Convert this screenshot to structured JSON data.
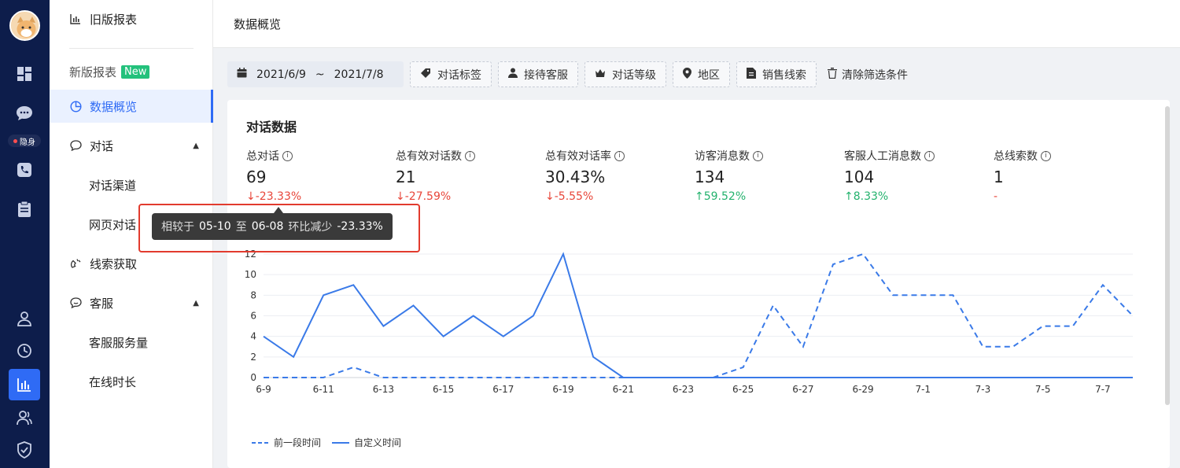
{
  "rail": {
    "status": "隐身",
    "icons": [
      "dashboard-icon",
      "chat-icon",
      "phone-icon",
      "clipboard-icon",
      "user-icon",
      "clock-icon",
      "chart-icon",
      "team-icon",
      "shield-icon"
    ]
  },
  "sidebar": {
    "old_report": "旧版报表",
    "new_report": "新版报表",
    "new_badge": "New",
    "items": [
      {
        "label": "数据概览"
      },
      {
        "label": "对话"
      },
      {
        "label": "对话渠道"
      },
      {
        "label": "网页对话"
      },
      {
        "label": "线索获取"
      },
      {
        "label": "客服"
      },
      {
        "label": "客服服务量"
      },
      {
        "label": "在线时长"
      }
    ]
  },
  "header": {
    "title": "数据概览"
  },
  "filters": {
    "date_start": "2021/6/9",
    "date_sep": "~",
    "date_end": "2021/7/8",
    "chips": [
      "对话标签",
      "接待客服",
      "对话等级",
      "地区",
      "销售线索"
    ],
    "clear": "清除筛选条件"
  },
  "card": {
    "title": "对话数据",
    "metrics": [
      {
        "label": "总对话",
        "value": "69",
        "change": "-23.33%",
        "dir": "down"
      },
      {
        "label": "总有效对话数",
        "value": "21",
        "change": "-27.59%",
        "dir": "down"
      },
      {
        "label": "总有效对话率",
        "value": "30.43%",
        "change": "-5.55%",
        "dir": "down"
      },
      {
        "label": "访客消息数",
        "value": "134",
        "change": "59.52%",
        "dir": "up"
      },
      {
        "label": "客服人工消息数",
        "value": "104",
        "change": "8.33%",
        "dir": "up"
      },
      {
        "label": "总线索数",
        "value": "1",
        "change": "-",
        "dir": "none"
      }
    ]
  },
  "tooltip": {
    "prefix": "相较于",
    "from": "05-10",
    "to_word": "至",
    "to": "06-08",
    "desc": "环比减少",
    "value": "-23.33%"
  },
  "chart_data": {
    "type": "line",
    "x": [
      "6-9",
      "6-10",
      "6-11",
      "6-12",
      "6-13",
      "6-14",
      "6-15",
      "6-16",
      "6-17",
      "6-18",
      "6-19",
      "6-20",
      "6-21",
      "6-22",
      "6-23",
      "6-24",
      "6-25",
      "6-26",
      "6-27",
      "6-28",
      "6-29",
      "6-30",
      "7-1",
      "7-2",
      "7-3",
      "7-4",
      "7-5",
      "7-6",
      "7-7",
      "7-8"
    ],
    "x_tick_labels": [
      "6-9",
      "6-11",
      "6-13",
      "6-15",
      "6-17",
      "6-19",
      "6-21",
      "6-23",
      "6-25",
      "6-27",
      "6-29",
      "7-1",
      "7-3",
      "7-5",
      "7-7"
    ],
    "y_ticks": [
      0,
      2,
      4,
      6,
      8,
      10,
      12
    ],
    "ylim": [
      0,
      12
    ],
    "series": [
      {
        "name": "前一段时间",
        "style": "dashed",
        "color": "#3a7ae8",
        "values": [
          0,
          0,
          0,
          1,
          0,
          0,
          0,
          0,
          0,
          0,
          0,
          0,
          0,
          0,
          0,
          0,
          1,
          7,
          3,
          11,
          12,
          8,
          8,
          8,
          3,
          3,
          5,
          5,
          9,
          6
        ]
      },
      {
        "name": "自定义时间",
        "style": "solid",
        "color": "#3a7ae8",
        "values": [
          4,
          2,
          8,
          9,
          5,
          7,
          4,
          6,
          4,
          6,
          12,
          2,
          0,
          0,
          0,
          0,
          0,
          0,
          0,
          0,
          0,
          0,
          0,
          0,
          0,
          0,
          0,
          0,
          0,
          0
        ]
      }
    ]
  },
  "colors": {
    "accent": "#2f6bf5",
    "rail": "#0d1d4b",
    "down": "#e8463a",
    "up": "#23b26d"
  }
}
